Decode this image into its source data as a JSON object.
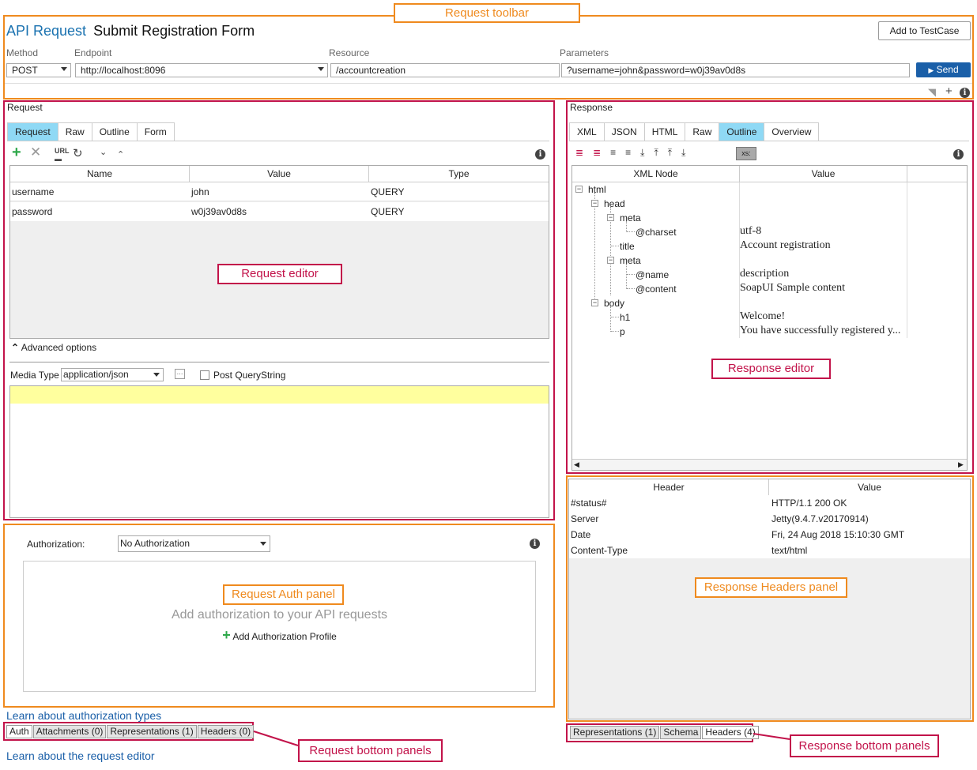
{
  "callouts": {
    "request_toolbar": "Request toolbar",
    "request_editor": "Request editor",
    "response_editor": "Response editor",
    "request_auth_panel": "Request Auth panel",
    "response_headers_panel": "Response Headers panel",
    "request_bottom_panels": "Request bottom panels",
    "response_bottom_panels": "Response bottom panels"
  },
  "toolbar": {
    "title_prefix": "API Request",
    "title": "Submit Registration Form",
    "add_to_testcase": "Add to TestCase",
    "method_label": "Method",
    "method_value": "POST",
    "endpoint_label": "Endpoint",
    "endpoint_value": "http://localhost:8096",
    "resource_label": "Resource",
    "resource_value": "/accountcreation",
    "parameters_label": "Parameters",
    "parameters_value": "?username=john&password=w0j39av0d8s",
    "send_label": "Send"
  },
  "request": {
    "panel_title": "Request",
    "tabs": [
      "Request",
      "Raw",
      "Outline",
      "Form"
    ],
    "active_tab": "Request",
    "columns": [
      "Name",
      "Value",
      "Type"
    ],
    "rows": [
      {
        "name": "username",
        "value": "john",
        "type": "QUERY"
      },
      {
        "name": "password",
        "value": "w0j39av0d8s",
        "type": "QUERY"
      }
    ],
    "advanced_options": "Advanced options",
    "media_type_label": "Media Type",
    "media_type_value": "application/json",
    "post_querystring": "Post QueryString"
  },
  "response": {
    "panel_title": "Response",
    "tabs": [
      "XML",
      "JSON",
      "HTML",
      "Raw",
      "Outline",
      "Overview"
    ],
    "active_tab": "Outline",
    "xsd_badge": "xs:",
    "columns": [
      "XML Node",
      "Value"
    ],
    "tree": [
      {
        "node": "html",
        "value": ""
      },
      {
        "node": "head",
        "value": ""
      },
      {
        "node": "meta",
        "value": ""
      },
      {
        "node": "@charset",
        "value": "utf-8"
      },
      {
        "node": "title",
        "value": "Account registration"
      },
      {
        "node": "meta",
        "value": ""
      },
      {
        "node": "@name",
        "value": "description"
      },
      {
        "node": "@content",
        "value": "SoapUI Sample content"
      },
      {
        "node": "body",
        "value": ""
      },
      {
        "node": "h1",
        "value": "Welcome!"
      },
      {
        "node": "p",
        "value": "You have successfully registered y..."
      }
    ]
  },
  "auth": {
    "label": "Authorization:",
    "value": "No Authorization",
    "empty_text": "Add authorization to your API requests",
    "add_profile": "Add Authorization Profile"
  },
  "headers": {
    "columns": [
      "Header",
      "Value"
    ],
    "rows": [
      {
        "header": "#status#",
        "value": "HTTP/1.1 200 OK"
      },
      {
        "header": "Server",
        "value": "Jetty(9.4.7.v20170914)"
      },
      {
        "header": "Date",
        "value": "Fri, 24 Aug 2018 15:10:30 GMT"
      },
      {
        "header": "Content-Type",
        "value": "text/html"
      }
    ]
  },
  "links": {
    "auth_types": "Learn about authorization types",
    "request_editor": "Learn about the request editor"
  },
  "request_bottom_tabs": [
    "Auth",
    "Attachments (0)",
    "Representations (1)",
    "Headers (0)"
  ],
  "response_bottom_tabs": [
    "Representations (1)",
    "Schema",
    "Headers (4)"
  ],
  "colors": {
    "orange": "#ef8a1e",
    "crimson": "#c2134a",
    "active_tab": "#8fd9f5",
    "send": "#1a5fa8",
    "media_bar": "#ffff9e"
  },
  "icons": [
    "plus-icon",
    "delete-icon",
    "url-icon",
    "refresh-icon",
    "move-down-icon",
    "move-up-icon",
    "info-icon",
    "close-panel-icon",
    "add-icon"
  ]
}
